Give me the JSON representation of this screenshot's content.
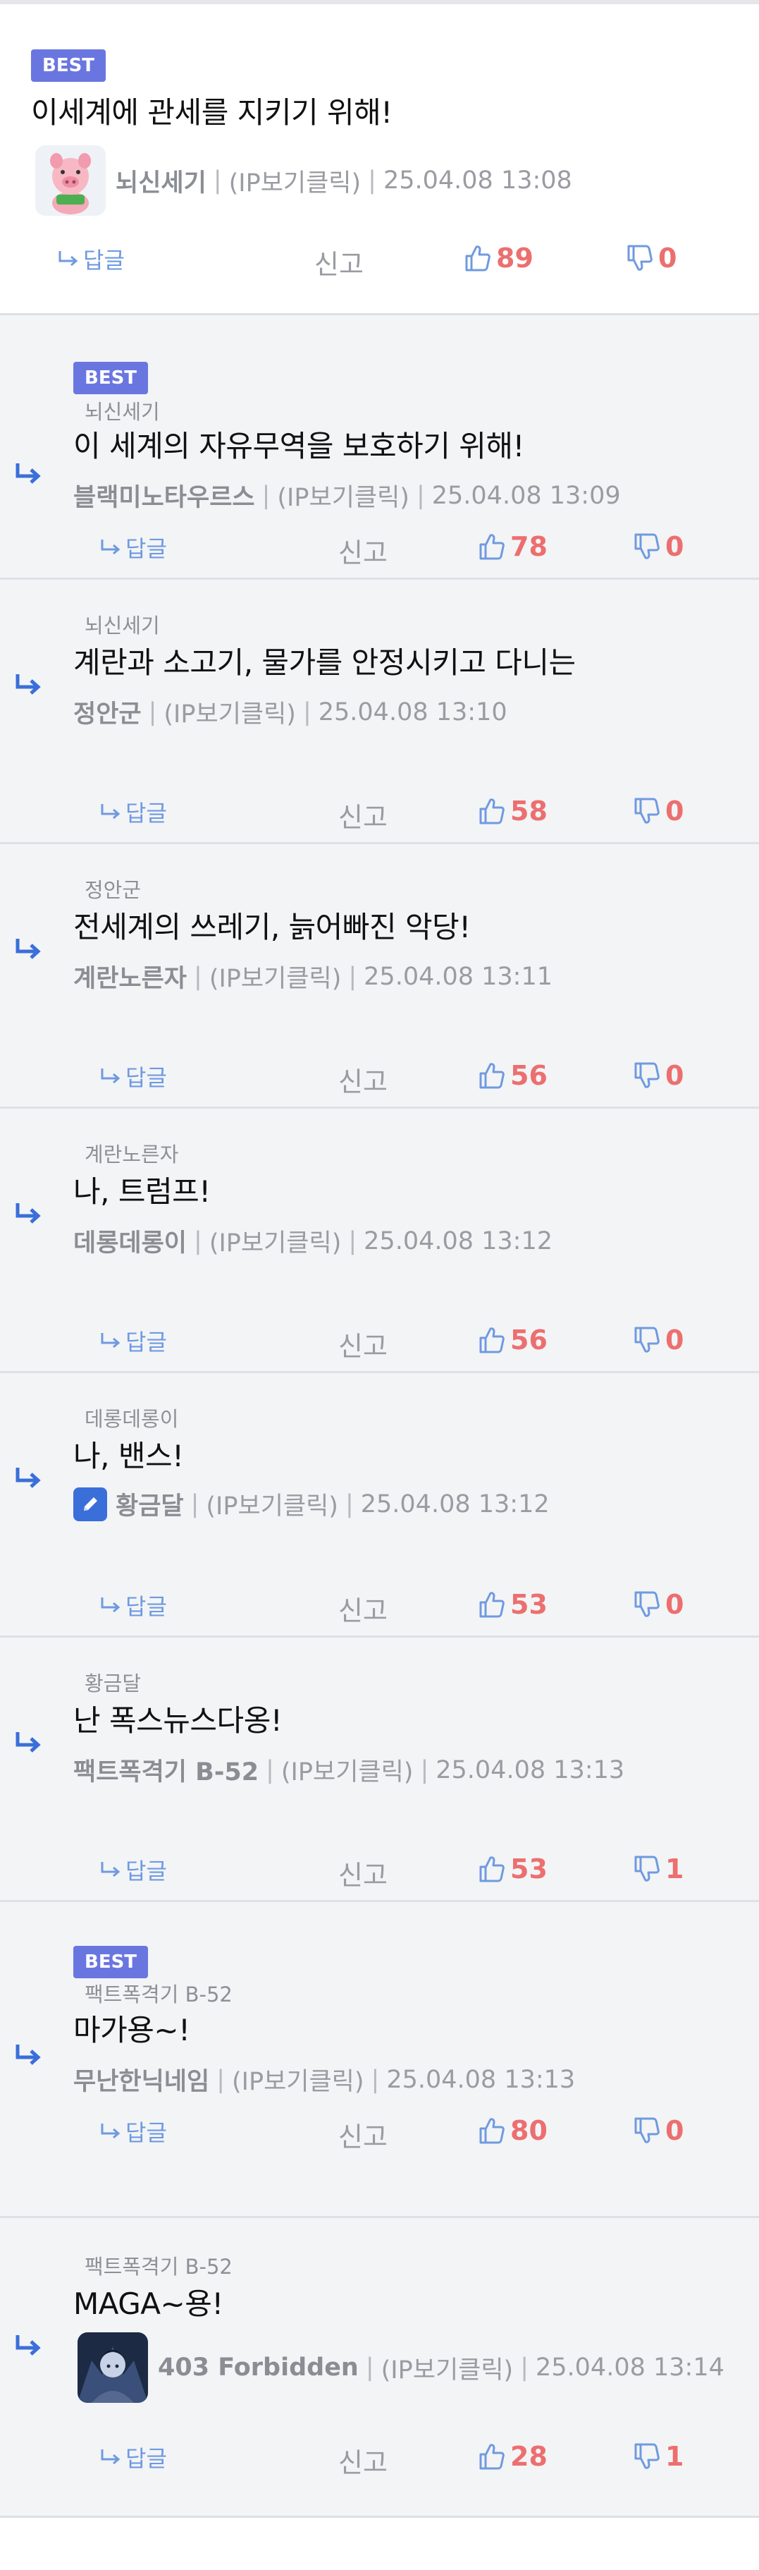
{
  "common": {
    "best_label": "BEST",
    "reply_label": "답글",
    "report_label": "신고",
    "ip_label": "(IP보기클릭)",
    "separator": "|"
  },
  "colors": {
    "accent": "#6a76e0",
    "like": "#ec6f6f",
    "reply": "#6f9ae0",
    "reply_bg": "#f3f4f6"
  },
  "comments": [
    {
      "best": true,
      "parent": "",
      "text": "이세계에 관세를 지키기 위해!",
      "author": "뇌신세기",
      "avatar": "pig-avatar-icon",
      "date": "25.04.08 13:08",
      "likes": "89",
      "dislikes": "0"
    },
    {
      "best": true,
      "parent": "뇌신세기",
      "text": "이 세계의 자유무역을 보호하기 위해!",
      "author": "블랙미노타우르스",
      "date": "25.04.08 13:09",
      "likes": "78",
      "dislikes": "0"
    },
    {
      "best": false,
      "parent": "뇌신세기",
      "text": "계란과 소고기, 물가를 안정시키고 다니는",
      "author": "정안군",
      "date": "25.04.08 13:10",
      "likes": "58",
      "dislikes": "0"
    },
    {
      "best": false,
      "parent": "정안군",
      "text": "전세계의 쓰레기, 늙어빠진 악당!",
      "author": "계란노른자",
      "date": "25.04.08 13:11",
      "likes": "56",
      "dislikes": "0"
    },
    {
      "best": false,
      "parent": "계란노른자",
      "text": "나, 트럼프!",
      "author": "데롱데롱이",
      "date": "25.04.08 13:12",
      "likes": "56",
      "dislikes": "0"
    },
    {
      "best": false,
      "parent": "데롱데롱이",
      "text": "나, 밴스!",
      "author": "황금달",
      "badge": "pencil-icon",
      "date": "25.04.08 13:12",
      "likes": "53",
      "dislikes": "0"
    },
    {
      "best": false,
      "parent": "황금달",
      "text": "난 폭스뉴스다옹!",
      "author": "팩트폭격기 B-52",
      "date": "25.04.08 13:13",
      "likes": "53",
      "dislikes": "1"
    },
    {
      "best": true,
      "parent": "팩트폭격기 B-52",
      "text": "마가용~!",
      "author": "무난한닉네임",
      "date": "25.04.08 13:13",
      "likes": "80",
      "dislikes": "0"
    },
    {
      "best": false,
      "parent": "팩트폭격기 B-52",
      "text": "MAGA~용!",
      "author": "403 Forbidden",
      "avatar": "dark-character-avatar-icon",
      "date": "25.04.08 13:14",
      "likes": "28",
      "dislikes": "1"
    }
  ]
}
